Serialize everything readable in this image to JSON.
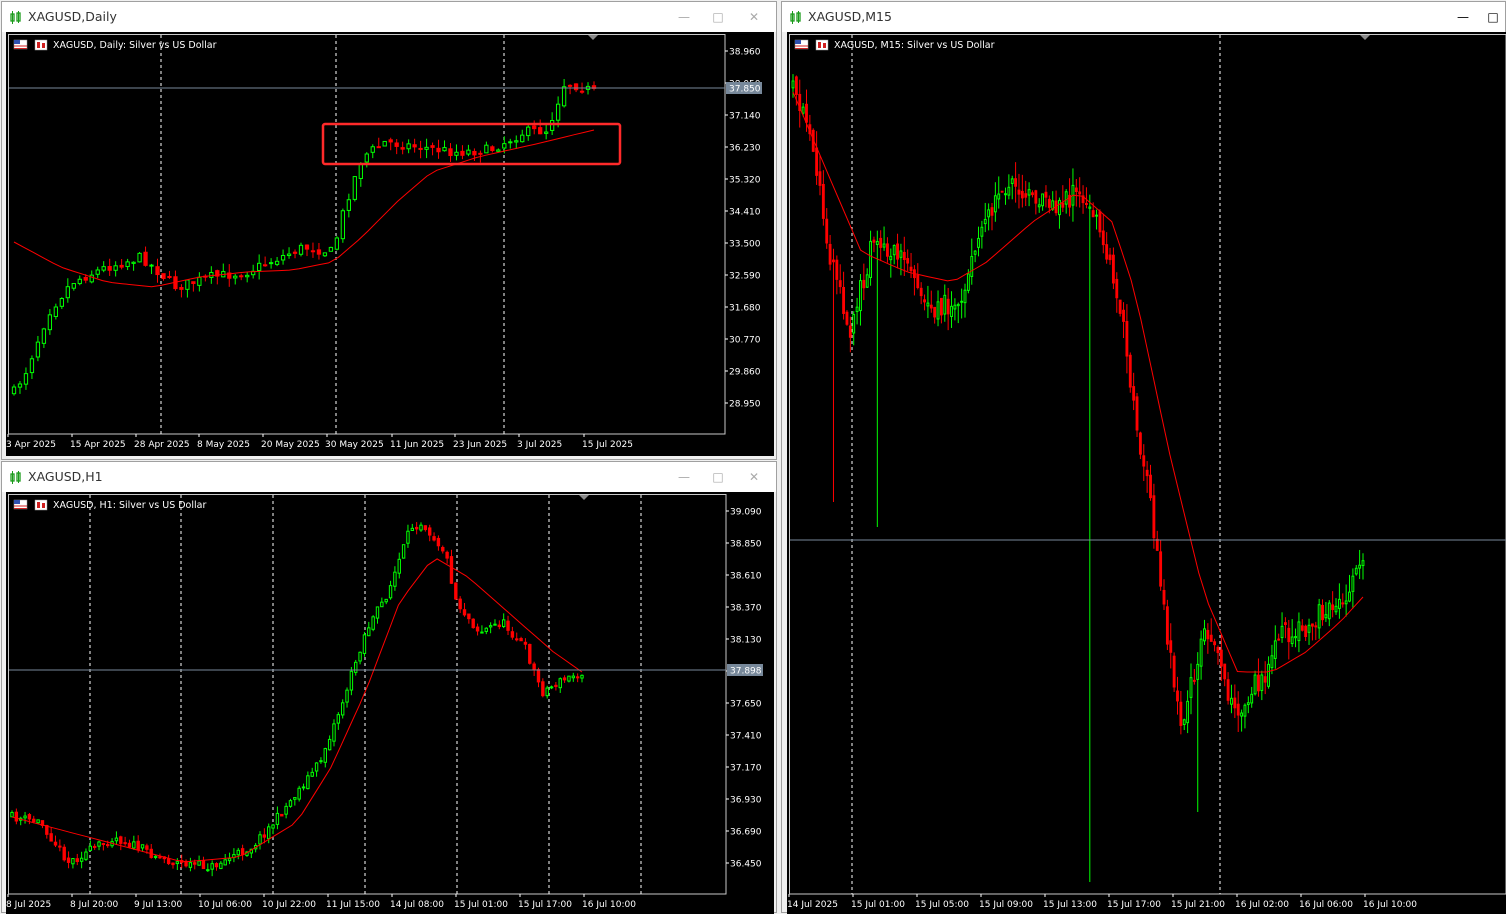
{
  "colors": {
    "bull": "#00ff00",
    "bear": "#ff0000",
    "ma": "#ff0000",
    "grid": "#ffffff",
    "axis_text": "#ffffff",
    "price_line": "#77889a",
    "highlight_box": "#ff2a2a"
  },
  "windows": [
    {
      "id": "daily",
      "title": "XAGUSD,Daily",
      "header": "XAGUSD, Daily:  Silver vs US Dollar",
      "price_labels": [
        "38.960",
        "38.050",
        "37.140",
        "36.230",
        "35.320",
        "34.410",
        "33.500",
        "32.590",
        "31.680",
        "30.770",
        "29.860",
        "28.950"
      ],
      "time_labels": [
        "3 Apr 2025",
        "15 Apr 2025",
        "28 Apr 2025",
        "8 May 2025",
        "20 May 2025",
        "30 May 2025",
        "11 Jun 2025",
        "23 Jun 2025",
        "3 Jul 2025",
        "15 Jul 2025"
      ],
      "current_price": "37.850"
    },
    {
      "id": "h1",
      "title": "XAGUSD,H1",
      "header": "XAGUSD, H1:  Silver vs US Dollar",
      "price_labels": [
        "39.090",
        "38.850",
        "38.610",
        "38.370",
        "38.130",
        "37.890",
        "37.650",
        "37.410",
        "37.170",
        "36.930",
        "36.690",
        "36.450"
      ],
      "time_labels": [
        "8 Jul 2025",
        "8 Jul 20:00",
        "9 Jul 13:00",
        "10 Jul 06:00",
        "10 Jul 22:00",
        "11 Jul 15:00",
        "14 Jul 08:00",
        "15 Jul 01:00",
        "15 Jul 17:00",
        "16 Jul 10:00"
      ],
      "current_price": "37.898"
    },
    {
      "id": "m15",
      "title": "XAGUSD,M15",
      "header": "XAGUSD, M15:  Silver vs US Dollar",
      "price_labels": [],
      "time_labels": [
        "14 Jul 2025",
        "15 Jul 01:00",
        "15 Jul 05:00",
        "15 Jul 09:00",
        "15 Jul 13:00",
        "15 Jul 17:00",
        "15 Jul 21:00",
        "16 Jul 02:00",
        "16 Jul 06:00",
        "16 Jul 10:00"
      ],
      "current_price": ""
    }
  ]
}
